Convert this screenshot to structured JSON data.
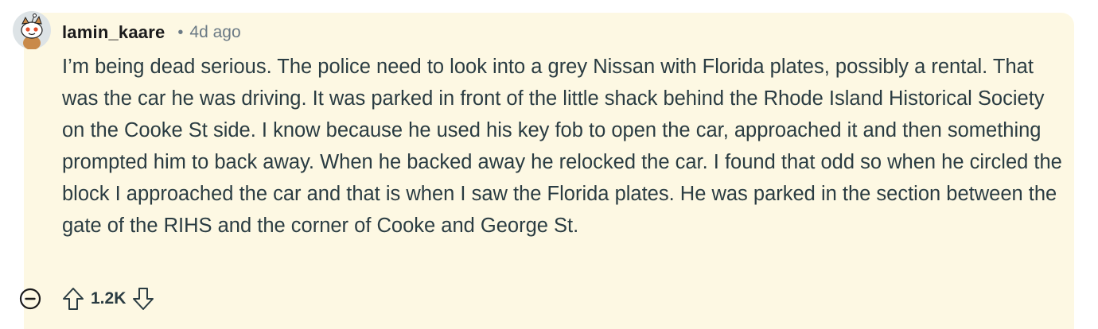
{
  "comment": {
    "author": "lamin_kaare",
    "separator": "•",
    "time_ago": "4d ago",
    "body": "I’m being dead serious. The police need to look into a grey Nissan with Florida plates, possibly a rental. That was the car he was driving. It was parked in front of the little shack behind the Rhode Island Historical Society on the Cooke St side. I know because he used his key fob to open the car, approached it and then something prompted him to back away. When he backed away he relocked the car. I found that odd so when he circled the block I approached the car and that is when I saw the Florida plates. He was parked in the section between the gate of the RIHS and the corner of Cooke and George St.",
    "score": "1.2K"
  },
  "colors": {
    "highlight_bg": "#fdf8e3",
    "text": "#2a3c42",
    "meta": "#6b7a85"
  },
  "icons": {
    "avatar": "snoo-avatar-icon",
    "collapse": "collapse-minus-icon",
    "upvote": "upvote-arrow-icon",
    "downvote": "downvote-arrow-icon"
  }
}
